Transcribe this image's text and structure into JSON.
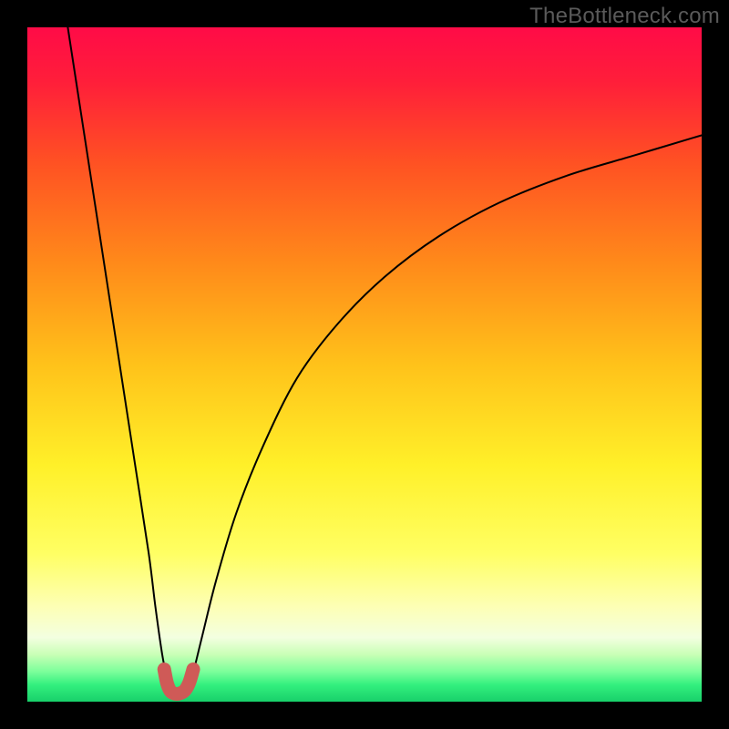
{
  "watermark": "TheBottleneck.com",
  "chart_data": {
    "type": "line",
    "title": "",
    "xlabel": "",
    "ylabel": "",
    "xlim": [
      0,
      100
    ],
    "ylim": [
      0,
      100
    ],
    "grid": false,
    "background": {
      "type": "vertical-gradient",
      "stops": [
        {
          "pos": 0.0,
          "color": "#ff0b47"
        },
        {
          "pos": 0.08,
          "color": "#ff1e3a"
        },
        {
          "pos": 0.2,
          "color": "#ff5123"
        },
        {
          "pos": 0.35,
          "color": "#ff8a1a"
        },
        {
          "pos": 0.5,
          "color": "#ffc21a"
        },
        {
          "pos": 0.65,
          "color": "#fff029"
        },
        {
          "pos": 0.78,
          "color": "#ffff63"
        },
        {
          "pos": 0.86,
          "color": "#fdffb6"
        },
        {
          "pos": 0.905,
          "color": "#f3ffe0"
        },
        {
          "pos": 0.93,
          "color": "#c9ffb6"
        },
        {
          "pos": 0.955,
          "color": "#7dff9b"
        },
        {
          "pos": 0.975,
          "color": "#33f07e"
        },
        {
          "pos": 1.0,
          "color": "#18d06a"
        }
      ]
    },
    "series": [
      {
        "name": "bottleneck-curve-left",
        "color": "#000000",
        "x": [
          6,
          8,
          10,
          12,
          14,
          16,
          18,
          19,
          20,
          20.8
        ],
        "y": [
          100,
          87,
          74,
          61,
          48,
          35,
          22,
          14,
          7,
          3
        ]
      },
      {
        "name": "bottleneck-curve-right",
        "color": "#000000",
        "x": [
          24.3,
          26,
          28,
          31,
          35,
          40,
          46,
          53,
          61,
          70,
          80,
          90,
          100
        ],
        "y": [
          3,
          10,
          18,
          28,
          38,
          48,
          56,
          63,
          69,
          74,
          78,
          81,
          84
        ]
      },
      {
        "name": "valley-marker",
        "type": "marker-path",
        "color": "#cf5a57",
        "stroke_width_px": 15,
        "x": [
          20.3,
          20.7,
          21.2,
          21.8,
          22.5,
          23.3,
          24.0,
          24.6
        ],
        "y": [
          4.8,
          2.8,
          1.6,
          1.2,
          1.2,
          1.6,
          2.8,
          4.8
        ]
      }
    ],
    "annotations": []
  }
}
